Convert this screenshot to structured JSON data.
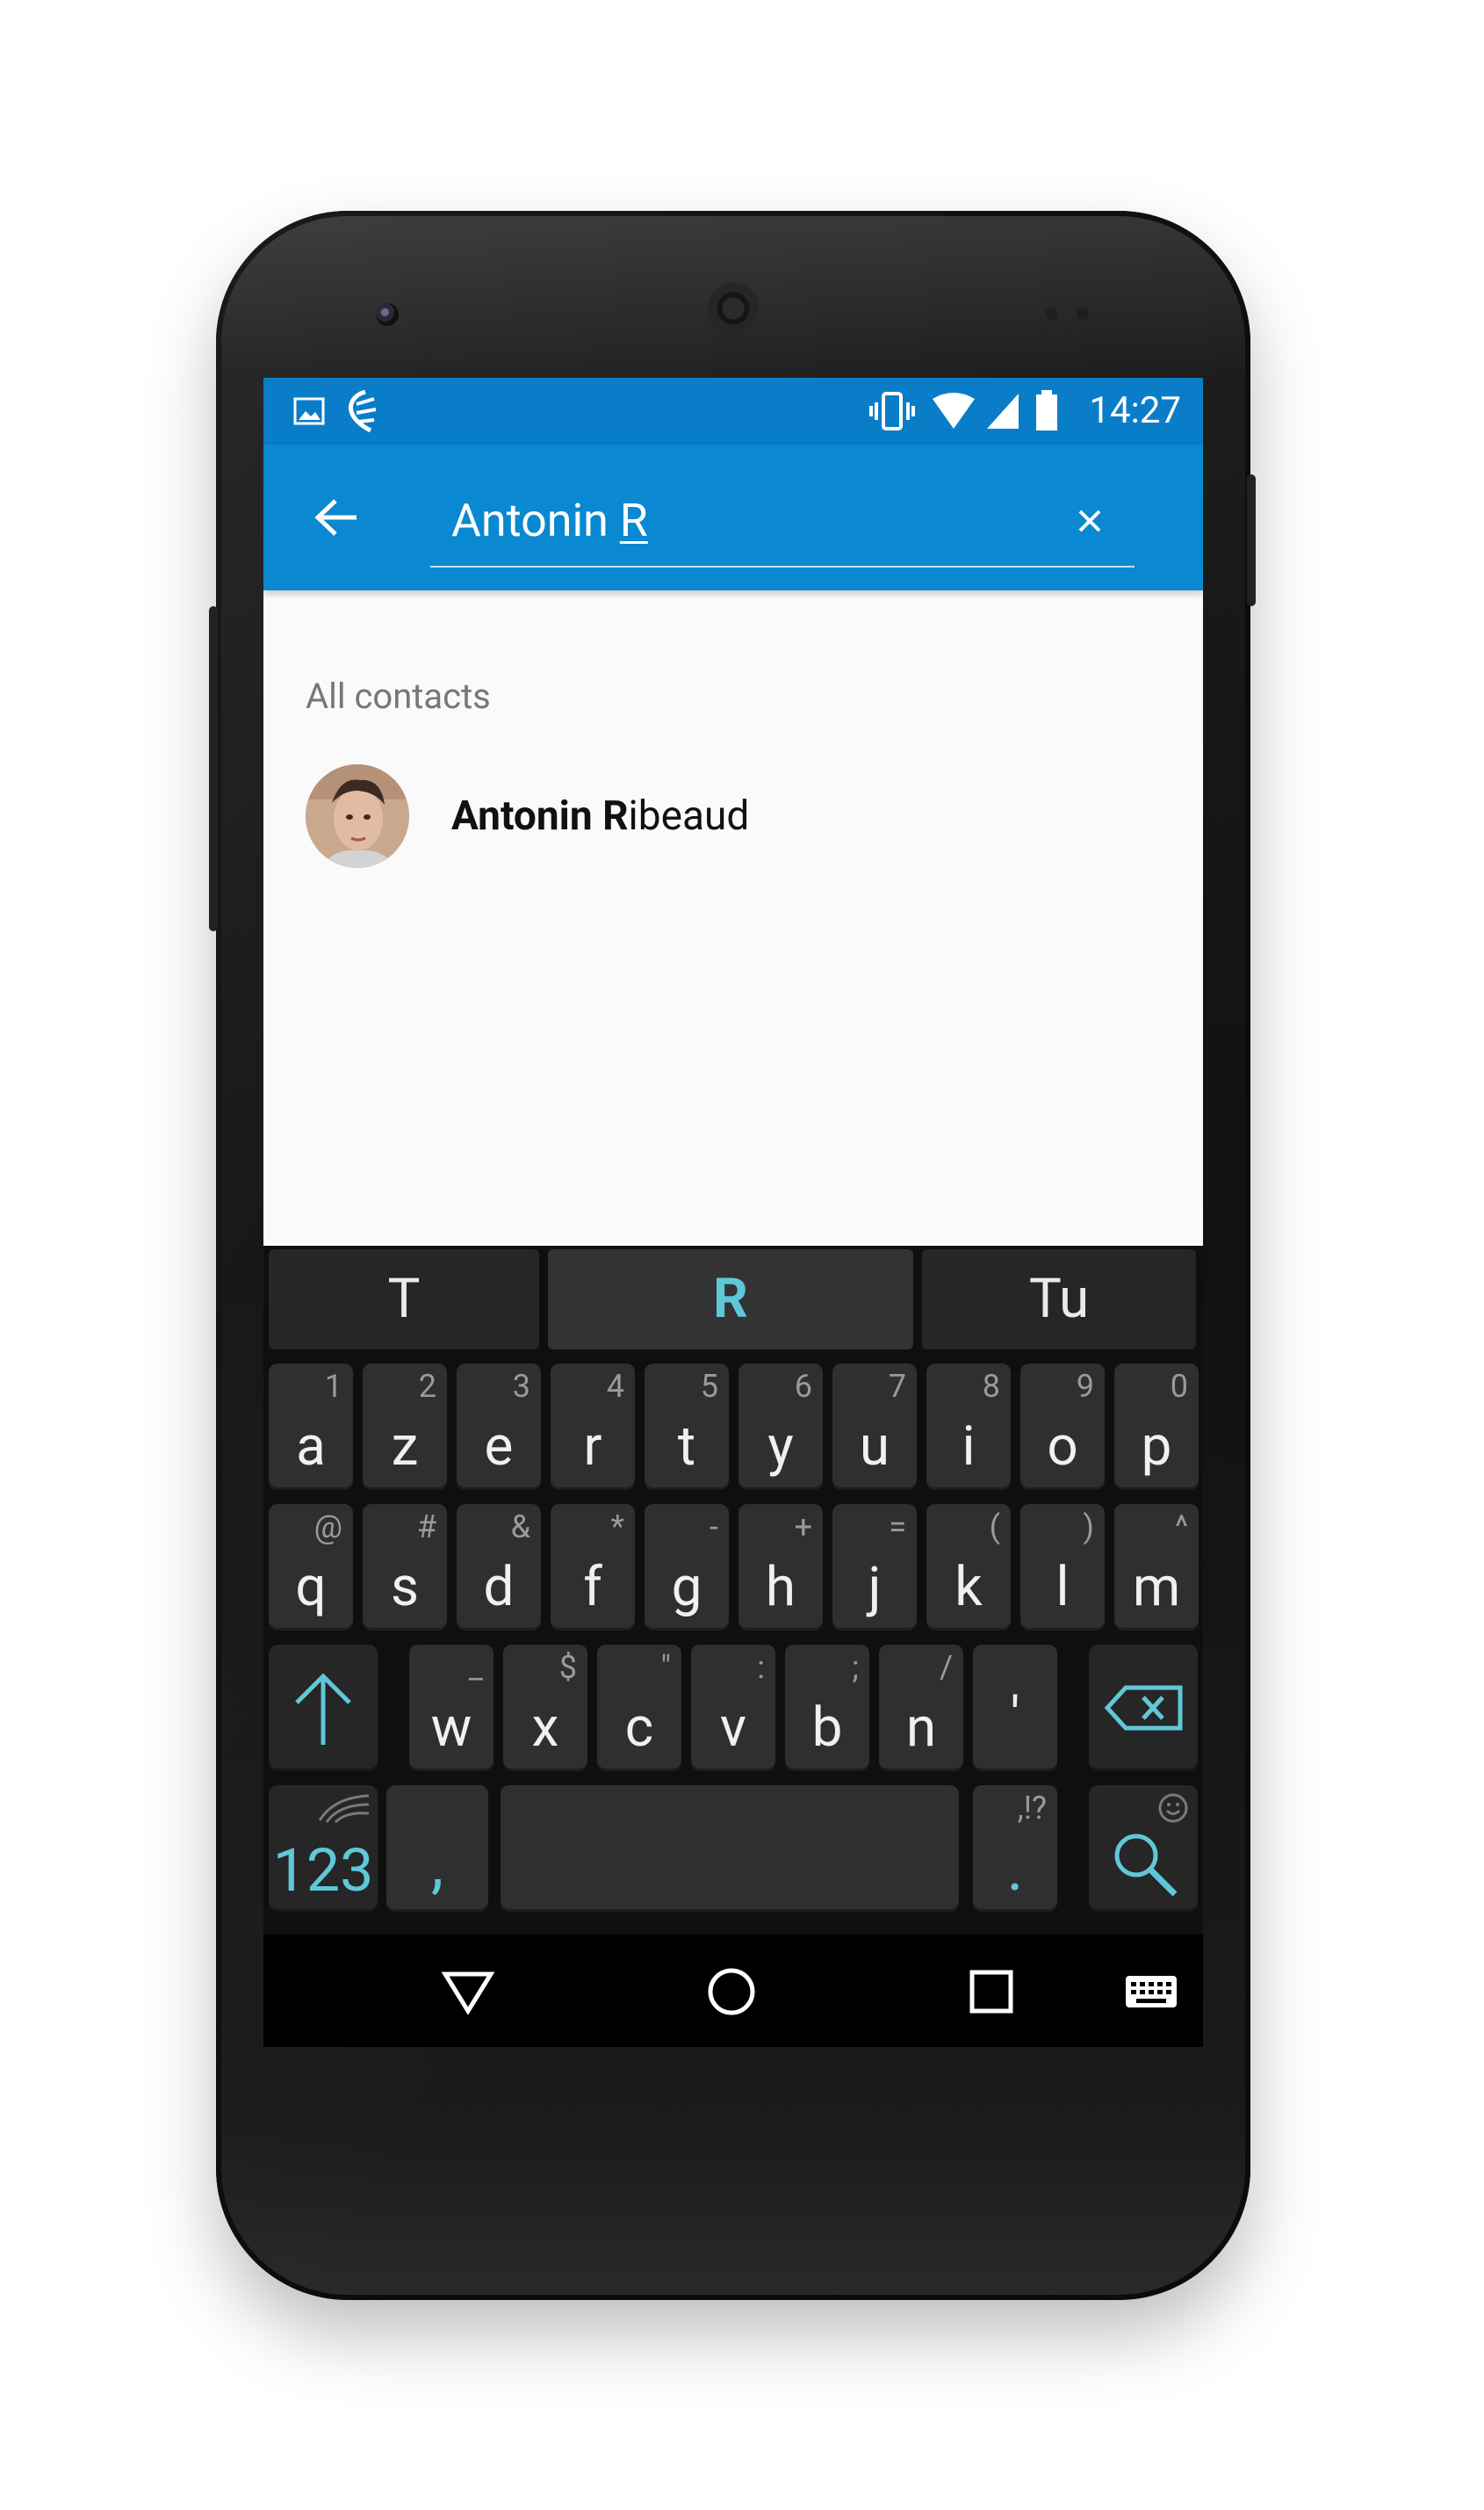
{
  "status_bar": {
    "time": "14:27",
    "left_icons": [
      "image-icon",
      "swiftkey-icon"
    ],
    "right_icons": [
      "vibrate-icon",
      "wifi-icon",
      "signal-icon",
      "battery-icon"
    ]
  },
  "search": {
    "query_prefix": "Antonin ",
    "query_underlined": "R"
  },
  "results": {
    "section_title": "All contacts",
    "contacts": [
      {
        "name_bold": "Antonin R",
        "name_rest": "ibeaud"
      }
    ]
  },
  "keyboard": {
    "suggestions": [
      "T",
      "R",
      "Tu"
    ],
    "row1": [
      {
        "main": "a",
        "sub": "1"
      },
      {
        "main": "z",
        "sub": "2"
      },
      {
        "main": "e",
        "sub": "3"
      },
      {
        "main": "r",
        "sub": "4"
      },
      {
        "main": "t",
        "sub": "5"
      },
      {
        "main": "y",
        "sub": "6"
      },
      {
        "main": "u",
        "sub": "7"
      },
      {
        "main": "i",
        "sub": "8"
      },
      {
        "main": "o",
        "sub": "9"
      },
      {
        "main": "p",
        "sub": "0"
      }
    ],
    "row2": [
      {
        "main": "q",
        "sub": "@"
      },
      {
        "main": "s",
        "sub": "#"
      },
      {
        "main": "d",
        "sub": "&"
      },
      {
        "main": "f",
        "sub": "*"
      },
      {
        "main": "g",
        "sub": "-"
      },
      {
        "main": "h",
        "sub": "+"
      },
      {
        "main": "j",
        "sub": "="
      },
      {
        "main": "k",
        "sub": "("
      },
      {
        "main": "l",
        "sub": ")"
      },
      {
        "main": "m",
        "sub": "^"
      }
    ],
    "row3": [
      {
        "main": "w",
        "sub": "_"
      },
      {
        "main": "x",
        "sub": "$"
      },
      {
        "main": "c",
        "sub": "\""
      },
      {
        "main": "v",
        "sub": ":"
      },
      {
        "main": "b",
        "sub": ";"
      },
      {
        "main": "n",
        "sub": "/"
      },
      {
        "main": "'",
        "sub": ""
      }
    ],
    "numbers_key": "123",
    "comma_key": ",",
    "period_key": ".",
    "period_sub": ",!?"
  },
  "colors": {
    "status_bar": "#0a7dc9",
    "toolbar": "#0a88d1",
    "accent": "#5fc8d8",
    "keyboard_bg": "#0f0f0f",
    "key_bg": "#2f2f2f"
  }
}
